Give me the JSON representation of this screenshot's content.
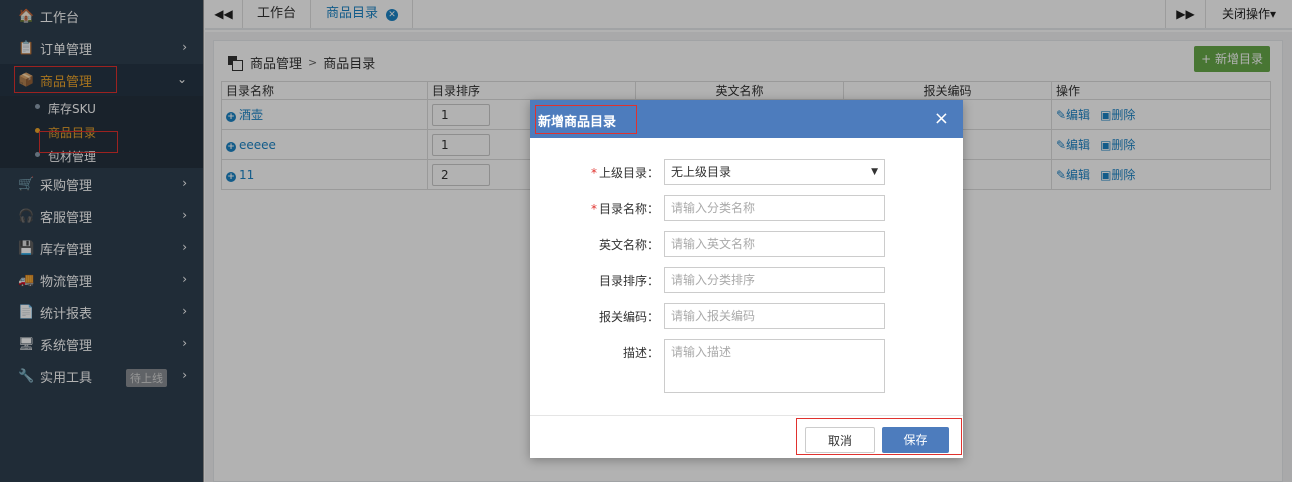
{
  "sidebar": {
    "items": [
      {
        "icon": "home-icon",
        "glyph": "🏠",
        "label": "工作台"
      },
      {
        "icon": "clipboard-icon",
        "glyph": "📋",
        "label": "订单管理"
      },
      {
        "icon": "cube-icon",
        "glyph": "📦",
        "label": "商品管理"
      },
      {
        "icon": "cart-icon",
        "glyph": "🛒",
        "label": "采购管理"
      },
      {
        "icon": "headphones-icon",
        "glyph": "🎧",
        "label": "客服管理"
      },
      {
        "icon": "hdd-icon",
        "glyph": "💾",
        "label": "库存管理"
      },
      {
        "icon": "truck-icon",
        "glyph": "🚚",
        "label": "物流管理"
      },
      {
        "icon": "report-icon",
        "glyph": "📄",
        "label": "统计报表"
      },
      {
        "icon": "desktop-icon",
        "glyph": "🖥",
        "label": "系统管理"
      },
      {
        "icon": "wrench-icon",
        "glyph": "🔧",
        "label": "实用工具"
      }
    ],
    "sub_items": [
      "库存SKU",
      "商品目录",
      "包材管理"
    ],
    "tool_badge": "待上线",
    "arrow_right": "›",
    "arrow_down": "⌄"
  },
  "tabbar": {
    "prev": "◀◀",
    "next": "▶▶",
    "tabs": [
      "工作台",
      "商品目录"
    ],
    "close_label": "关闭操作▾",
    "close_tab": "✕"
  },
  "content": {
    "breadcrumb": [
      "商品管理",
      "商品目录"
    ],
    "breadcrumb_sep": ">",
    "add_button": "+ 新增目录",
    "table": {
      "headers": [
        "目录名称",
        "目录排序",
        "英文名称",
        "报关编码",
        "操作"
      ],
      "rows": [
        {
          "name": "酒壶",
          "sort": "1"
        },
        {
          "name": "eeeee",
          "sort": "1"
        },
        {
          "name": "11",
          "sort": "2"
        }
      ],
      "edit_label": "✎编辑",
      "delete_label": "▣删除"
    }
  },
  "modal": {
    "title": "新增商品目录",
    "close": "×",
    "fields": {
      "parent": {
        "label": "上级目录：",
        "value": "无上级目录",
        "required": true
      },
      "name": {
        "label": "目录名称：",
        "placeholder": "请输入分类名称",
        "required": true
      },
      "english": {
        "label": "英文名称：",
        "placeholder": "请输入英文名称"
      },
      "sort": {
        "label": "目录排序：",
        "placeholder": "请输入分类排序"
      },
      "customs": {
        "label": "报关编码：",
        "placeholder": "请输入报关编码"
      },
      "desc": {
        "label": "描述：",
        "placeholder": "请输入描述"
      }
    },
    "required_mark": "*",
    "cancel": "取消",
    "save": "保存"
  },
  "colors": {
    "sidebar_bg": "#2f4050",
    "accent_blue": "#1c84c6",
    "modal_header": "#4d7cbd",
    "active_orange": "#f0a62b",
    "add_green": "#67a94a",
    "annotation_red": "#e0322e"
  }
}
